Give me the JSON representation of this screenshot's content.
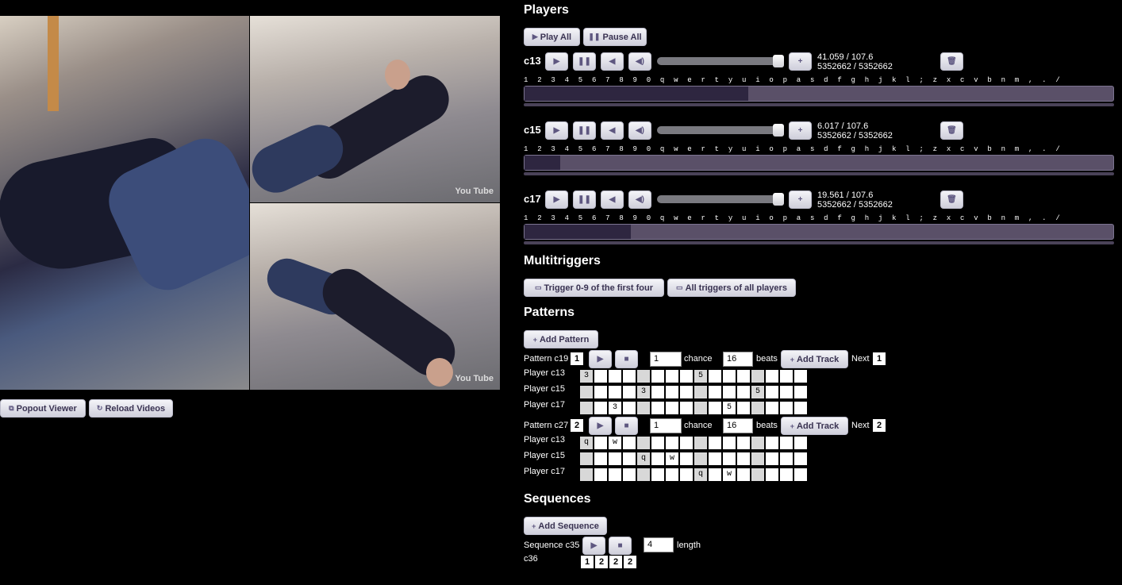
{
  "viewer": {
    "popout_label": "Popout Viewer",
    "reload_label": "Reload Videos",
    "watermark": "You Tube"
  },
  "players": {
    "heading": "Players",
    "play_all": "Play All",
    "pause_all": "Pause All",
    "keys": [
      "1",
      "2",
      "3",
      "4",
      "5",
      "6",
      "7",
      "8",
      "9",
      "0",
      "q",
      "w",
      "e",
      "r",
      "t",
      "y",
      "u",
      "i",
      "o",
      "p",
      "a",
      "s",
      "d",
      "f",
      "g",
      "h",
      "j",
      "k",
      "l",
      ";",
      "z",
      "x",
      "c",
      "v",
      "b",
      "n",
      "m",
      ",",
      ".",
      "/"
    ],
    "items": [
      {
        "name": "c13",
        "time": "41.059 / 107.6",
        "bytes": "5352662 / 5352662",
        "progress": 0.38
      },
      {
        "name": "c15",
        "time": "6.017 / 107.6",
        "bytes": "5352662 / 5352662",
        "progress": 0.06
      },
      {
        "name": "c17",
        "time": "19.561 / 107.6",
        "bytes": "5352662 / 5352662",
        "progress": 0.18
      }
    ]
  },
  "multitriggers": {
    "heading": "Multitriggers",
    "trigger_first_four": "Trigger 0-9 of the first four",
    "all_triggers": "All triggers of all players"
  },
  "patterns": {
    "heading": "Patterns",
    "add_pattern": "Add Pattern",
    "chance_label": "chance",
    "beats_label": "beats",
    "add_track": "Add Track",
    "next_label": "Next",
    "items": [
      {
        "name": "Pattern c19",
        "number": "1",
        "chance": "1",
        "beats": "16",
        "next": "1",
        "tracks": [
          {
            "label": "Player c13",
            "cells": [
              "3",
              "",
              "",
              "",
              "",
              "",
              "",
              "",
              "5",
              "",
              "",
              "",
              "",
              "",
              "",
              ""
            ]
          },
          {
            "label": "Player c15",
            "cells": [
              "",
              "",
              "",
              "",
              "3",
              "",
              "",
              "",
              "",
              "",
              "",
              "",
              "5",
              "",
              "",
              ""
            ]
          },
          {
            "label": "Player c17",
            "cells": [
              "",
              "",
              "3",
              "",
              "",
              "",
              "",
              "",
              "",
              "",
              "5",
              "",
              "",
              "",
              "",
              ""
            ]
          }
        ]
      },
      {
        "name": "Pattern c27",
        "number": "2",
        "chance": "1",
        "beats": "16",
        "next": "2",
        "tracks": [
          {
            "label": "Player c13",
            "cells": [
              "q",
              "",
              "w",
              "",
              "",
              "",
              "",
              "",
              "",
              "",
              "",
              "",
              "",
              "",
              "",
              ""
            ]
          },
          {
            "label": "Player c15",
            "cells": [
              "",
              "",
              "",
              "",
              "q",
              "",
              "w",
              "",
              "",
              "",
              "",
              "",
              "",
              "",
              "",
              ""
            ]
          },
          {
            "label": "Player c17",
            "cells": [
              "",
              "",
              "",
              "",
              "",
              "",
              "",
              "",
              "q",
              "",
              "w",
              "",
              "",
              "",
              "",
              ""
            ]
          }
        ]
      }
    ]
  },
  "sequences": {
    "heading": "Sequences",
    "add_sequence": "Add Sequence",
    "name": "Sequence c35",
    "length_value": "4",
    "length_label": "length",
    "sub_label": "c36",
    "steps": [
      "1",
      "2",
      "2",
      "2"
    ]
  }
}
